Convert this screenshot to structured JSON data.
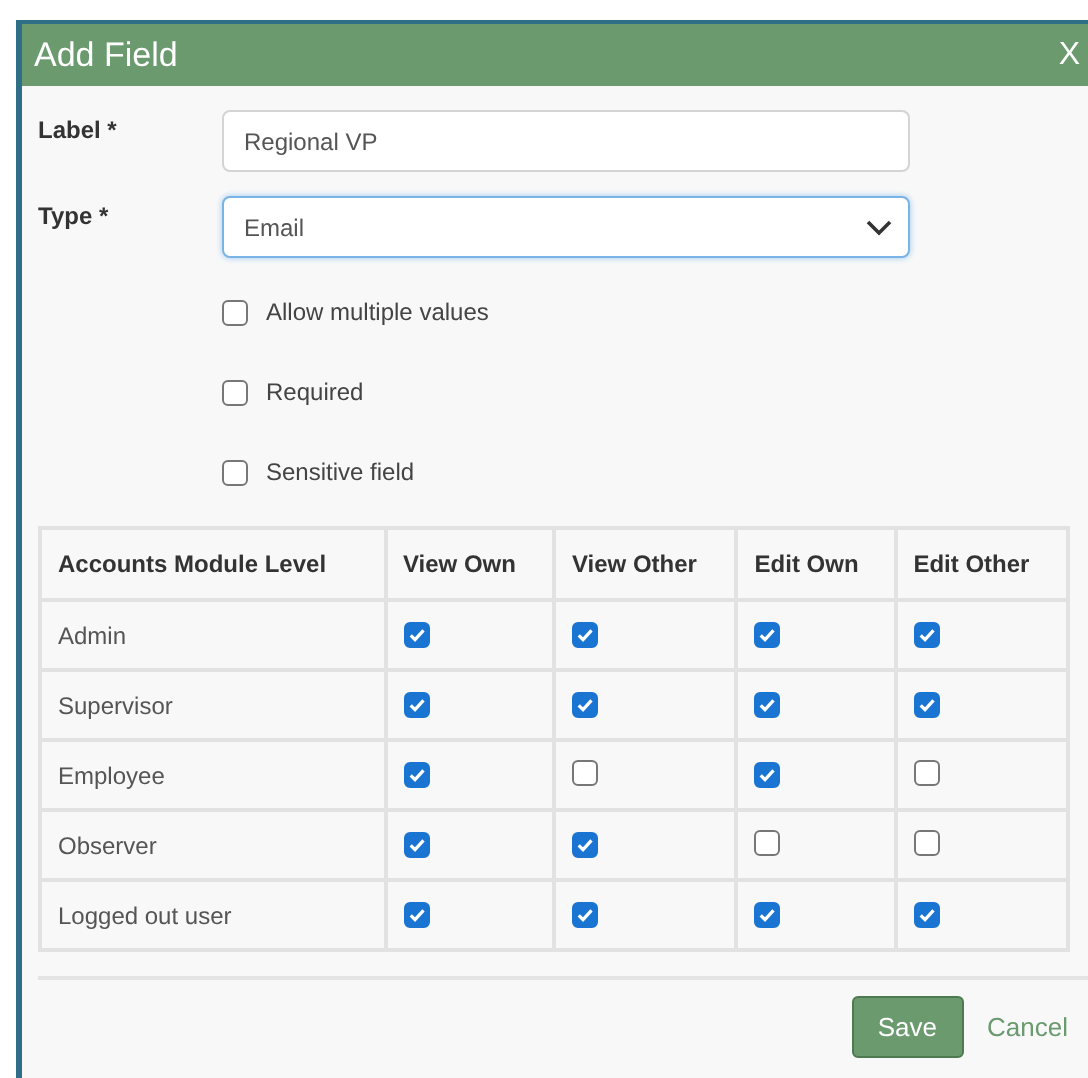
{
  "dialog": {
    "title": "Add Field",
    "close": "X"
  },
  "fields": [
    {
      "label": "Label *",
      "kind": "text",
      "value": "Regional VP",
      "focused": false
    },
    {
      "label": "Type *",
      "kind": "select",
      "value": "Email",
      "focused": true
    }
  ],
  "options": [
    {
      "label": "Allow multiple values",
      "checked": false
    },
    {
      "label": "Required",
      "checked": false
    },
    {
      "label": "Sensitive field",
      "checked": false
    }
  ],
  "table": {
    "columns": [
      "Accounts Module Level",
      "View Own",
      "View Other",
      "Edit Own",
      "Edit Other"
    ],
    "rows": [
      {
        "level": "Admin",
        "checks": [
          true,
          true,
          true,
          true
        ]
      },
      {
        "level": "Supervisor",
        "checks": [
          true,
          true,
          true,
          true
        ]
      },
      {
        "level": "Employee",
        "checks": [
          true,
          false,
          true,
          false
        ]
      },
      {
        "level": "Observer",
        "checks": [
          true,
          true,
          false,
          false
        ]
      },
      {
        "level": "Logged out user",
        "checks": [
          true,
          true,
          true,
          true
        ]
      }
    ]
  },
  "buttons": {
    "save": "Save",
    "cancel": "Cancel"
  }
}
